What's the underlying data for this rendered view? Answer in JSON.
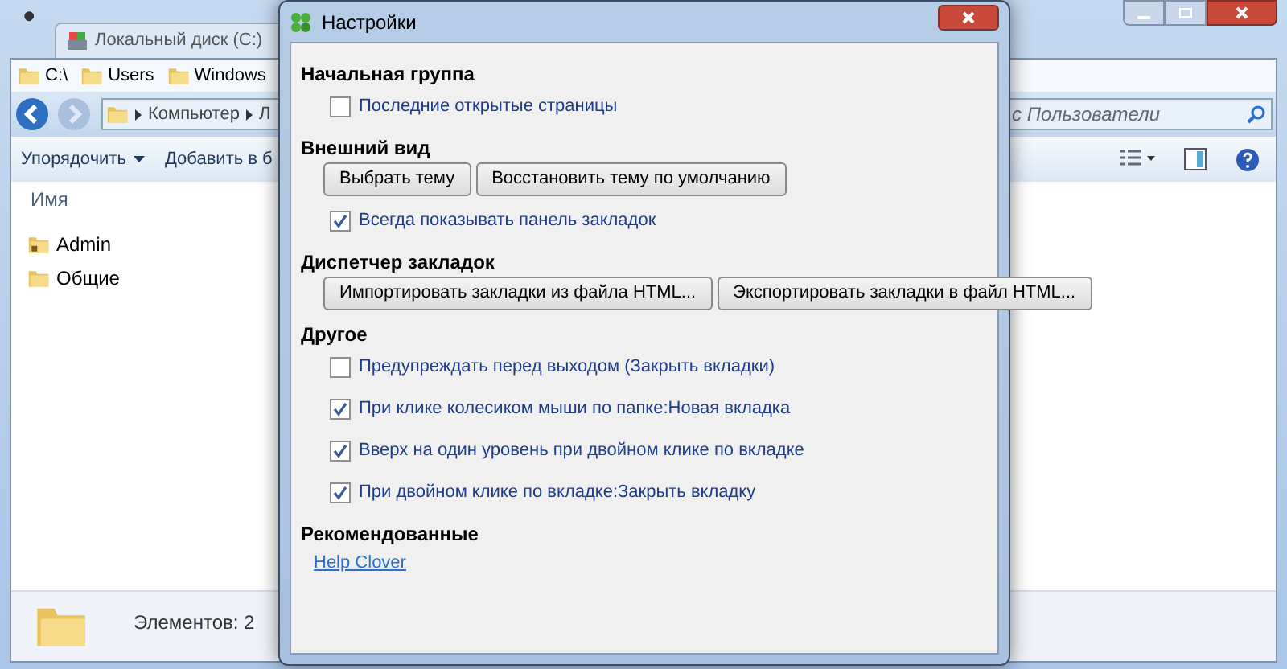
{
  "explorer": {
    "tab": "Локальный диск (C:)",
    "bookmarks": [
      "C:\\",
      "Users",
      "Windows"
    ],
    "address": [
      "Компьютер",
      "Л"
    ],
    "search": {
      "placeholder": "с Пользователи"
    },
    "toolbar": [
      "Упорядочить",
      "Добавить в б"
    ],
    "column": "Имя",
    "files": [
      {
        "name": "Admin",
        "kind": "locked"
      },
      {
        "name": "Общие",
        "kind": "folder"
      }
    ],
    "status": "Элементов: 2"
  },
  "dialog": {
    "title": "Настройки",
    "sections": [
      {
        "title": "Начальная группа",
        "items": [
          {
            "kind": "checkbox",
            "label": "Последние открытые страницы",
            "checked": false
          }
        ]
      },
      {
        "title": "Внешний вид",
        "items": [
          {
            "kind": "buttons",
            "buttons": [
              "Выбрать тему",
              "Восстановить тему по умолчанию"
            ]
          },
          {
            "kind": "checkbox",
            "label": "Всегда показывать панель закладок",
            "checked": true
          }
        ]
      },
      {
        "title": "Диспетчер закладок",
        "items": [
          {
            "kind": "buttons",
            "buttons": [
              "Импортировать закладки из файла HTML...",
              "Экспортировать закладки в файл HTML..."
            ]
          }
        ]
      },
      {
        "title": "Другое",
        "items": [
          {
            "kind": "checkbox",
            "label": "Предупреждать перед выходом (Закрыть вкладки)",
            "checked": false
          },
          {
            "kind": "checkbox",
            "label": "При клике колесиком мыши по папке:Новая вкладка",
            "checked": true
          },
          {
            "kind": "checkbox",
            "label": "Вверх на один уровень при двойном клике по вкладке",
            "checked": true
          },
          {
            "kind": "checkbox",
            "label": "При двойном клике по вкладке:Закрыть вкладку",
            "checked": true
          }
        ]
      },
      {
        "title": "Рекомендованные",
        "items": [
          {
            "kind": "link",
            "label": "Help Clover"
          }
        ]
      }
    ]
  }
}
